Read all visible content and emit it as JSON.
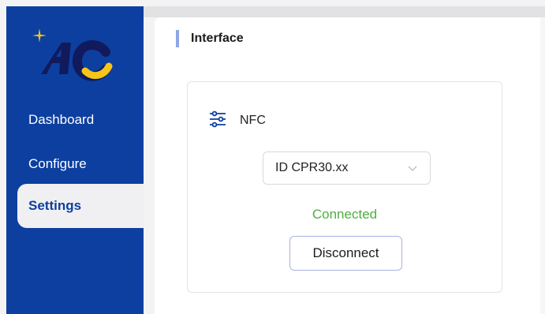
{
  "app": {
    "logo_name": "AC logo"
  },
  "colors": {
    "sidebar": "#0c3fa0",
    "accent_yellow": "#f5c518",
    "status_connected": "#4caf3d"
  },
  "sidebar": {
    "items": [
      {
        "label": "Dashboard",
        "active": false
      },
      {
        "label": "Configure",
        "active": false
      },
      {
        "label": "Settings",
        "active": true
      }
    ]
  },
  "main": {
    "section_title": "Interface",
    "card": {
      "icon": "sliders-icon",
      "title": "NFC",
      "device_select": {
        "value": "ID CPR30.xx"
      },
      "status": "Connected",
      "disconnect_label": "Disconnect"
    }
  }
}
